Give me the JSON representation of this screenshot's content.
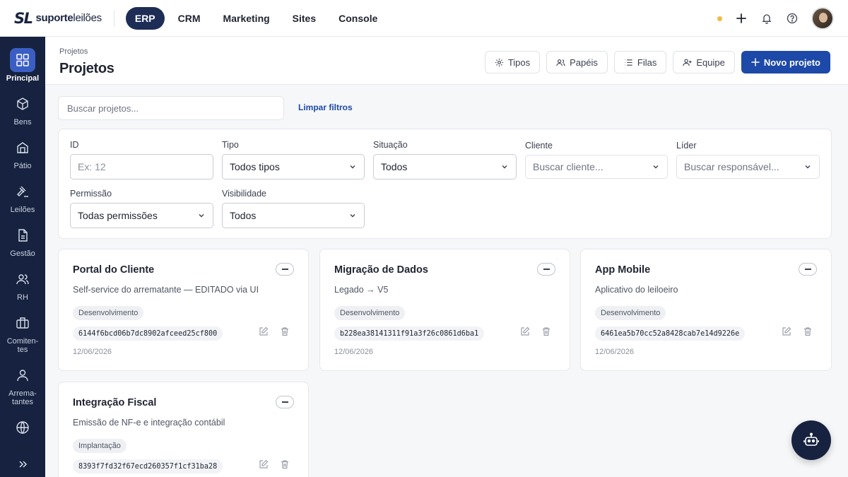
{
  "brand": {
    "mark": "SL",
    "name_bold": "suporte",
    "name_rest": "leilões"
  },
  "topnav": [
    {
      "label": "ERP",
      "active": true
    },
    {
      "label": "CRM"
    },
    {
      "label": "Marketing"
    },
    {
      "label": "Sites"
    },
    {
      "label": "Console"
    }
  ],
  "sidebar": [
    {
      "label": "Principal",
      "icon": "grid-icon",
      "active": true
    },
    {
      "label": "Bens",
      "icon": "box-icon"
    },
    {
      "label": "Pátio",
      "icon": "building-icon"
    },
    {
      "label": "Leilões",
      "icon": "gavel-icon"
    },
    {
      "label": "Gestão",
      "icon": "document-icon"
    },
    {
      "label": "RH",
      "icon": "users-icon"
    },
    {
      "label": "Comiten-tes",
      "icon": "briefcase-icon"
    },
    {
      "label": "Arrema-tantes",
      "icon": "user-icon"
    },
    {
      "label": "",
      "icon": "globe-icon"
    }
  ],
  "header": {
    "breadcrumb": "Projetos",
    "title": "Projetos",
    "actions": {
      "tipos": "Tipos",
      "papeis": "Papéis",
      "filas": "Filas",
      "equipe": "Equipe",
      "novo": "Novo projeto"
    }
  },
  "search": {
    "placeholder": "Buscar projetos...",
    "clear_label": "Limpar filtros"
  },
  "filters": {
    "id": {
      "label": "ID",
      "placeholder": "Ex: 12"
    },
    "tipo": {
      "label": "Tipo",
      "value": "Todos tipos"
    },
    "situacao": {
      "label": "Situação",
      "value": "Todos"
    },
    "cliente": {
      "label": "Cliente",
      "placeholder": "Buscar cliente..."
    },
    "lider": {
      "label": "Líder",
      "placeholder": "Buscar responsável..."
    },
    "permissao": {
      "label": "Permissão",
      "value": "Todas permissões"
    },
    "visibilidade": {
      "label": "Visibilidade",
      "value": "Todos"
    }
  },
  "projects": [
    {
      "title": "Portal do Cliente",
      "desc": "Self-service do arrematante — EDITADO via UI",
      "status": "Desenvolvimento",
      "hash": "6144f6bcd06b7dc8902afceed25cf800",
      "date": "12/06/2026"
    },
    {
      "title": "Migração de Dados",
      "desc": "Legado → V5",
      "status": "Desenvolvimento",
      "hash": "b228ea38141311f91a3f26c0861d6ba1",
      "date": "12/06/2026"
    },
    {
      "title": "App Mobile",
      "desc": "Aplicativo do leiloeiro",
      "status": "Desenvolvimento",
      "hash": "6461ea5b70cc52a8428cab7e14d9226e",
      "date": "12/06/2026"
    },
    {
      "title": "Integração Fiscal",
      "desc": "Emissão de NF-e e integração contábil",
      "status": "Implantação",
      "hash": "8393f7fd32f67ecd260357f1cf31ba28",
      "date": ""
    }
  ],
  "colors": {
    "sidebar": "#16223f",
    "primary": "#1d49a8",
    "accent_active": "#3a5ec4",
    "status_dot": "#f5b942"
  }
}
